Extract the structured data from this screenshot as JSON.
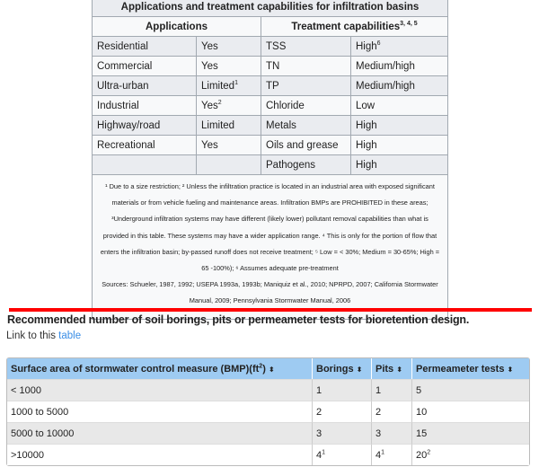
{
  "table1": {
    "caption": "Applications and treatment capabilities for infiltration basins",
    "headers": {
      "applications": "Applications",
      "treatment": "Treatment capabilities",
      "treatment_sup": "3, 4, 5"
    },
    "rows": [
      {
        "app": "Residential",
        "app_val": "Yes",
        "app_sup": "",
        "param": "TSS",
        "cap": "High",
        "cap_sup": "6"
      },
      {
        "app": "Commercial",
        "app_val": "Yes",
        "app_sup": "",
        "param": "TN",
        "cap": "Medium/high",
        "cap_sup": ""
      },
      {
        "app": "Ultra-urban",
        "app_val": "Limited",
        "app_sup": "1",
        "param": "TP",
        "cap": "Medium/high",
        "cap_sup": ""
      },
      {
        "app": "Industrial",
        "app_val": "Yes",
        "app_sup": "2",
        "param": "Chloride",
        "cap": "Low",
        "cap_sup": ""
      },
      {
        "app": "Highway/road",
        "app_val": "Limited",
        "app_sup": "",
        "param": "Metals",
        "cap": "High",
        "cap_sup": ""
      },
      {
        "app": "Recreational",
        "app_val": "Yes",
        "app_sup": "",
        "param": "Oils and grease",
        "cap": "High",
        "cap_sup": ""
      },
      {
        "app": "",
        "app_val": "",
        "app_sup": "",
        "param": "Pathogens",
        "cap": "High",
        "cap_sup": ""
      }
    ],
    "notes": "¹ Due to a size restriction; ² Unless the infiltration practice is located in an industrial area with exposed significant materials or from vehicle fueling and maintenance areas. Infiltration BMPs are PROHIBITED in these areas; ³Underground infiltration systems may have different (likely lower) pollutant removal capabilities than what is provided in this table. These systems may have a wider application range. ⁴ This is only for the portion of flow that enters the infiltration basin; by-passed runoff does not receive treatment; ⁵ Low = < 30%; Medium = 30-65%; High = 65 -100%); ⁶ Assumes adequate pre-treatment",
    "sources": "Sources: Schueler, 1987, 1992; USEPA 1993a, 1993b; Maniquiz et al., 2010; NPRPD, 2007; California Stormwater Manual, 2009; Pennsylvania Stormwater Manual, 2006"
  },
  "divider_color": "#ff0000",
  "section": {
    "heading": "Recommended number of soil borings, pits or permeameter tests for bioretention design.",
    "link_prefix": "Link to this ",
    "link_text": "table"
  },
  "table2": {
    "header_color": "#9ecbf2",
    "headers": [
      {
        "label": "Surface area of stormwater control measure (BMP)(ft",
        "sup": "2",
        "suffix": ")"
      },
      {
        "label": "Borings"
      },
      {
        "label": "Pits"
      },
      {
        "label": "Permeameter tests"
      }
    ],
    "sort_icon": "⬍",
    "rows": [
      {
        "area": "< 1000",
        "borings": "1",
        "b_sup": "",
        "pits": "1",
        "p_sup": "",
        "tests": "5",
        "t_sup": ""
      },
      {
        "area": "1000 to 5000",
        "borings": "2",
        "b_sup": "",
        "pits": "2",
        "p_sup": "",
        "tests": "10",
        "t_sup": ""
      },
      {
        "area": "5000 to 10000",
        "borings": "3",
        "b_sup": "",
        "pits": "3",
        "p_sup": "",
        "tests": "15",
        "t_sup": ""
      },
      {
        "area": ">10000",
        "borings": "4",
        "b_sup": "1",
        "pits": "4",
        "p_sup": "1",
        "tests": "20",
        "t_sup": "2"
      }
    ]
  }
}
